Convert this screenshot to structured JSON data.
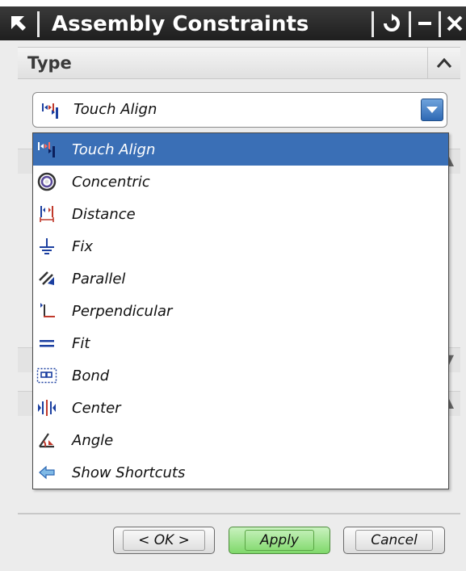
{
  "window": {
    "title": "Assembly Constraints",
    "title_icon": "select-arrow-icon",
    "buttons": [
      "reset-icon",
      "minimize-icon",
      "close-icon"
    ]
  },
  "type_panel": {
    "label": "Type",
    "collapsed": false,
    "selected_value": "Touch Align"
  },
  "dropdown": {
    "options": [
      {
        "label": "Touch Align",
        "icon": "touch-align-icon",
        "selected": true
      },
      {
        "label": "Concentric",
        "icon": "concentric-icon"
      },
      {
        "label": "Distance",
        "icon": "distance-icon"
      },
      {
        "label": "Fix",
        "icon": "fix-icon"
      },
      {
        "label": "Parallel",
        "icon": "parallel-icon"
      },
      {
        "label": "Perpendicular",
        "icon": "perpendicular-icon"
      },
      {
        "label": "Fit",
        "icon": "fit-icon"
      },
      {
        "label": "Bond",
        "icon": "bond-icon"
      },
      {
        "label": "Center",
        "icon": "center-icon"
      },
      {
        "label": "Angle",
        "icon": "angle-icon"
      },
      {
        "label": "Show Shortcuts",
        "icon": "show-shortcuts-icon"
      }
    ]
  },
  "footer": {
    "ok_label": "< OK >",
    "apply_label": "Apply",
    "cancel_label": "Cancel"
  },
  "colors": {
    "titlebar": "#1e1e1e",
    "selection": "#3a6fb6",
    "apply_green": "#7fd86a"
  }
}
